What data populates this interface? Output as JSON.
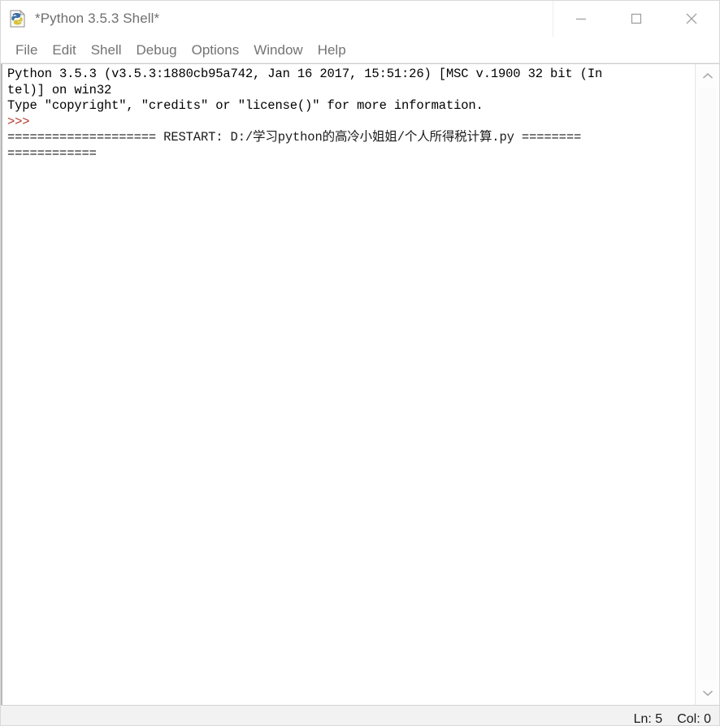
{
  "window": {
    "title": "*Python 3.5.3 Shell*",
    "icon": "python-idle-icon",
    "controls": {
      "minimize": "minimize-icon",
      "maximize": "maximize-icon",
      "close": "close-icon"
    }
  },
  "menubar": {
    "items": [
      {
        "label": "File"
      },
      {
        "label": "Edit"
      },
      {
        "label": "Shell"
      },
      {
        "label": "Debug"
      },
      {
        "label": "Options"
      },
      {
        "label": "Window"
      },
      {
        "label": "Help"
      }
    ]
  },
  "shell": {
    "lines": [
      {
        "kind": "output",
        "text": "Python 3.5.3 (v3.5.3:1880cb95a742, Jan 16 2017, 15:51:26) [MSC v.1900 32 bit (In"
      },
      {
        "kind": "output",
        "text": "tel)] on win32"
      },
      {
        "kind": "output",
        "text": "Type \"copyright\", \"credits\" or \"license()\" for more information."
      },
      {
        "kind": "prompt",
        "text": ">>>"
      },
      {
        "kind": "restart",
        "text": "==================== RESTART: D:/学习python的高冷小姐姐/个人所得税计算.py ========"
      },
      {
        "kind": "restart",
        "text": "============"
      }
    ]
  },
  "scrollbar": {
    "up_arrow": "chevron-up-icon",
    "down_arrow": "chevron-down-icon"
  },
  "statusbar": {
    "line_label": "Ln: 5",
    "col_label": "Col: 0"
  },
  "colors": {
    "prompt": "#b53a2e",
    "text": "#000000",
    "title": "#6f6f6f",
    "menu": "#737373",
    "status_bg": "#f2f2f2",
    "background": "#ffffff"
  }
}
